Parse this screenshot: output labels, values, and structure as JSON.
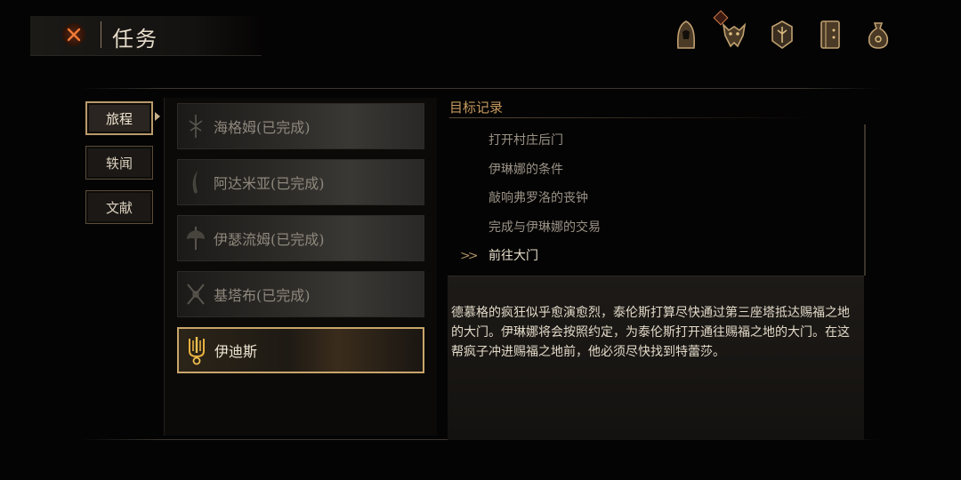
{
  "header": {
    "title": "任务",
    "close_icon": "close-x-icon"
  },
  "top_icons": [
    {
      "name": "hooded-figure-icon"
    },
    {
      "name": "beast-skull-icon",
      "notification": true
    },
    {
      "name": "crest-shield-icon"
    },
    {
      "name": "journal-book-icon"
    },
    {
      "name": "coin-bag-icon"
    }
  ],
  "side_tabs": [
    {
      "label": "旅程",
      "active": true
    },
    {
      "label": "轶闻",
      "active": false
    },
    {
      "label": "文献",
      "active": false
    }
  ],
  "quests": [
    {
      "label": "海格姆(已完成)",
      "icon": "sigil-icon",
      "completed": true
    },
    {
      "label": "阿达米亚(已完成)",
      "icon": "blade-icon",
      "completed": true
    },
    {
      "label": "伊瑟流姆(已完成)",
      "icon": "axe-icon",
      "completed": true
    },
    {
      "label": "基塔布(已完成)",
      "icon": "crossed-swords-icon",
      "completed": true
    },
    {
      "label": "伊迪斯",
      "icon": "flame-emblem-icon",
      "completed": false,
      "active": true
    }
  ],
  "objective_log": {
    "title": "目标记录",
    "objectives": [
      {
        "label": "打开村庄后门",
        "current": false
      },
      {
        "label": "伊琳娜的条件",
        "current": false
      },
      {
        "label": "敲响弗罗洛的丧钟",
        "current": false
      },
      {
        "label": "完成与伊琳娜的交易",
        "current": false
      },
      {
        "label": "前往大门",
        "current": true
      }
    ],
    "description": "德慕格的疯狂似乎愈演愈烈，泰伦斯打算尽快通过第三座塔抵达赐福之地的大门。伊琳娜将会按照约定，为泰伦斯打开通往赐福之地的大门。在这帮疯子冲进赐福之地前，他必须尽快找到特蕾莎。"
  },
  "colors": {
    "accent_gold": "#c9a66a",
    "log_title": "#c49a5e",
    "close_orange": "#e0682a"
  }
}
